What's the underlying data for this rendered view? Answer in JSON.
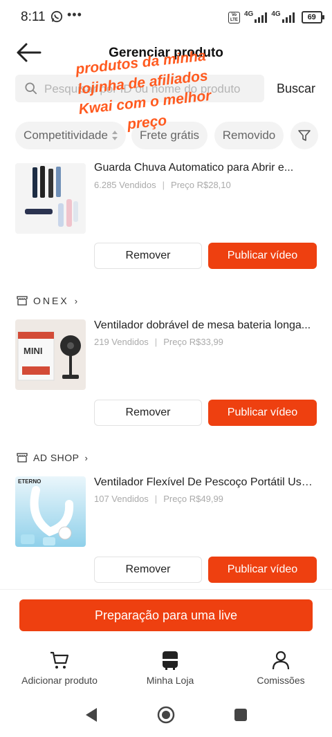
{
  "status": {
    "time": "8:11",
    "network_left": "4G",
    "network_right": "4G",
    "battery": "69"
  },
  "header": {
    "title": "Gerenciar produto"
  },
  "search": {
    "placeholder": "Pesquisar por ID ou nome do produto",
    "button": "Buscar"
  },
  "filters": [
    "Competitividade",
    "Frete grátis",
    "Removido"
  ],
  "overlay_text": [
    "produtos da minha",
    "lojinha de afiliados",
    "Kwai com o melhor",
    "preço"
  ],
  "products": [
    {
      "shop": "",
      "name": "Guarda Chuva Automatico para Abrir e...",
      "sold": "6.285 Vendidos",
      "price": "Preço R$28,10",
      "remove": "Remover",
      "publish": "Publicar vídeo"
    },
    {
      "shop": "ONEX",
      "name": "Ventilador dobrável de mesa bateria longa...",
      "sold": "219 Vendidos",
      "price": "Preço R$33,99",
      "remove": "Remover",
      "publish": "Publicar vídeo"
    },
    {
      "shop": "AD SHOP",
      "name": "Ventilador Flexível De Pescoço Portátil Usb...",
      "sold": "107 Vendidos",
      "price": "Preço R$49,99",
      "remove": "Remover",
      "publish": "Publicar vídeo"
    }
  ],
  "product_image_text": {
    "p2_brand": "MINI",
    "p3_brand": "ETERNO"
  },
  "live_button": "Preparação para uma live",
  "bottom_tabs": [
    "Adicionar produto",
    "Minha Loja",
    "Comissões"
  ],
  "colors": {
    "accent": "#ee4010",
    "overlay": "#ff5a1f"
  }
}
